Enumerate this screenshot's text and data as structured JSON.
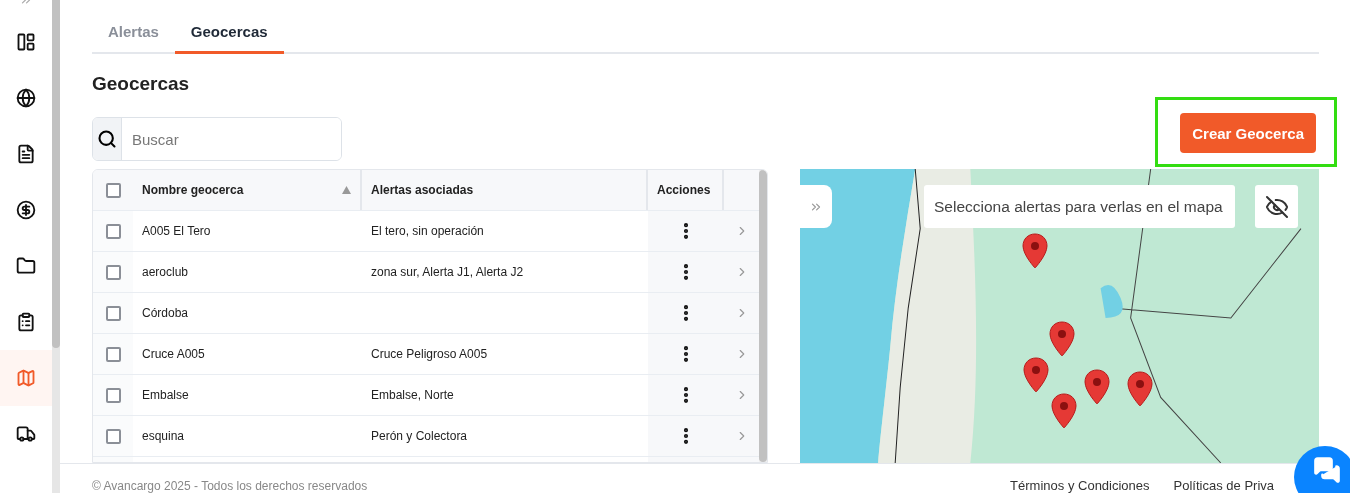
{
  "sidebar": {
    "items": [
      {
        "selected": false
      },
      {
        "selected": false
      },
      {
        "selected": false
      },
      {
        "selected": false
      },
      {
        "selected": false
      },
      {
        "selected": false
      },
      {
        "selected": true
      },
      {
        "selected": false
      }
    ]
  },
  "tabs": [
    {
      "label": "Alertas",
      "selected": false
    },
    {
      "label": "Geocercas",
      "selected": true
    }
  ],
  "title": "Geocercas",
  "search": {
    "placeholder": "Buscar"
  },
  "create_button": {
    "label": "Crear Geocerca",
    "highlighted": true
  },
  "table": {
    "all_checked": false,
    "columns": [
      "Nombre geocerca",
      "Alertas asociadas",
      "Acciones"
    ],
    "rows": [
      {
        "name": "A005 El Tero",
        "alerts": "El tero, sin operación",
        "checked": false
      },
      {
        "name": "aeroclub",
        "alerts": "zona sur, Alerta J1, Alerta J2",
        "checked": false
      },
      {
        "name": "Córdoba",
        "alerts": "",
        "checked": false
      },
      {
        "name": "Cruce A005",
        "alerts": "Cruce Peligroso A005",
        "checked": false
      },
      {
        "name": "Embalse",
        "alerts": "Embalse, Norte",
        "checked": false
      },
      {
        "name": "esquina",
        "alerts": "Perón y Colectora",
        "checked": false
      }
    ]
  },
  "map": {
    "alert_placeholder": "Selecciona alertas para verlas en el mapa"
  },
  "footer": {
    "copyright": "© Avancargo 2025 - Todos los derechos reservados",
    "links": [
      "Términos y Condiciones",
      "Políticas de Priva"
    ]
  }
}
